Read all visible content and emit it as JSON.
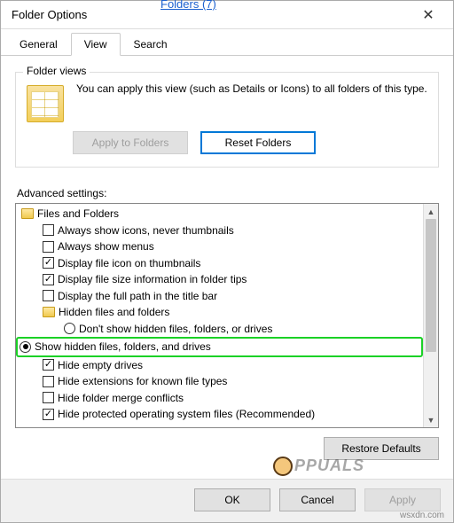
{
  "partial_text": "Folders (7)",
  "window": {
    "title": "Folder Options",
    "close_glyph": "✕"
  },
  "tabs": {
    "general": "General",
    "view": "View",
    "search": "Search"
  },
  "folder_views": {
    "legend": "Folder views",
    "description": "You can apply this view (such as Details or Icons) to all folders of this type.",
    "apply_btn": "Apply to Folders",
    "reset_btn": "Reset Folders"
  },
  "advanced": {
    "label": "Advanced settings:",
    "root": "Files and Folders",
    "items": [
      {
        "type": "check",
        "checked": false,
        "label": "Always show icons, never thumbnails"
      },
      {
        "type": "check",
        "checked": false,
        "label": "Always show menus"
      },
      {
        "type": "check",
        "checked": true,
        "label": "Display file icon on thumbnails"
      },
      {
        "type": "check",
        "checked": true,
        "label": "Display file size information in folder tips"
      },
      {
        "type": "check",
        "checked": false,
        "label": "Display the full path in the title bar"
      }
    ],
    "hidden_group": "Hidden files and folders",
    "hidden_options": [
      {
        "selected": false,
        "label": "Don't show hidden files, folders, or drives"
      },
      {
        "selected": true,
        "label": "Show hidden files, folders, and drives"
      }
    ],
    "items2": [
      {
        "type": "check",
        "checked": true,
        "label": "Hide empty drives"
      },
      {
        "type": "check",
        "checked": false,
        "label": "Hide extensions for known file types"
      },
      {
        "type": "check",
        "checked": false,
        "label": "Hide folder merge conflicts"
      },
      {
        "type": "check",
        "checked": true,
        "label": "Hide protected operating system files (Recommended)"
      }
    ],
    "restore_btn": "Restore Defaults"
  },
  "footer": {
    "ok": "OK",
    "cancel": "Cancel",
    "apply": "Apply"
  },
  "watermark": "PPUALS",
  "source": "wsxdn.com"
}
